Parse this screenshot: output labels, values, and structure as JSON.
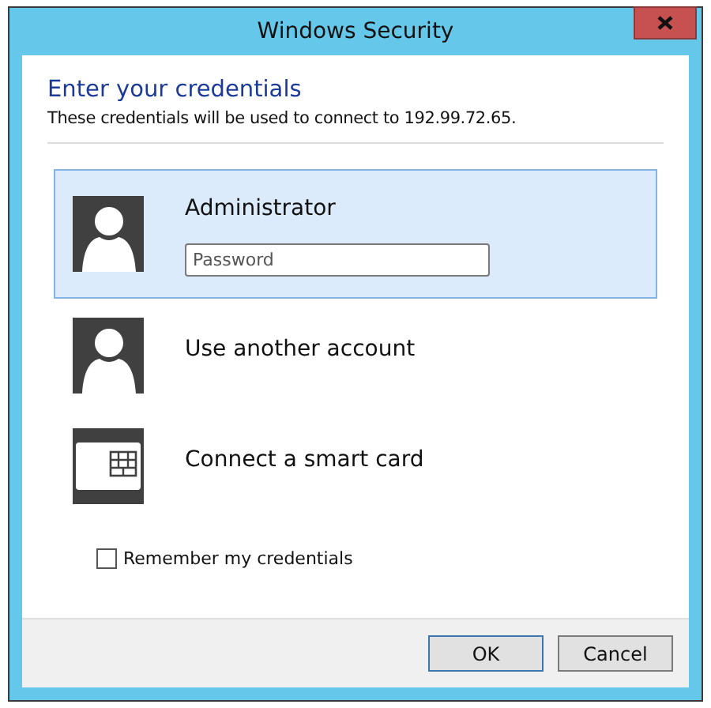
{
  "window": {
    "title": "Windows Security"
  },
  "heading": "Enter your credentials",
  "subtitle": "These credentials will be used to connect to 192.99.72.65.",
  "options": [
    {
      "kind": "user",
      "label": "Administrator",
      "selected": true,
      "password": {
        "placeholder": "Password"
      }
    },
    {
      "kind": "user",
      "label": "Use another account",
      "selected": false
    },
    {
      "kind": "smartcard",
      "label": "Connect a smart card",
      "selected": false
    }
  ],
  "remember": {
    "label": "Remember my credentials",
    "checked": false
  },
  "buttons": [
    {
      "label": "OK",
      "default": true
    },
    {
      "label": "Cancel",
      "default": false
    }
  ]
}
